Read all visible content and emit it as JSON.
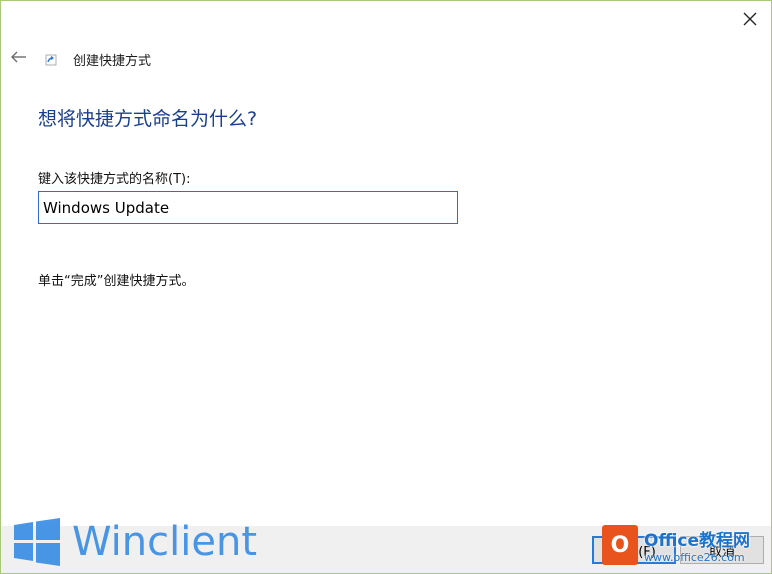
{
  "window": {
    "title": "创建快捷方式"
  },
  "icons": {
    "close": "close-icon",
    "back": "back-arrow-icon",
    "wizard": "shortcut-wizard-icon"
  },
  "main": {
    "heading": "想将快捷方式命名为什么?",
    "field_label": "键入该快捷方式的名称(T):",
    "name_value": "Windows Update",
    "hint": "单击“完成”创建快捷方式。"
  },
  "footer": {
    "finish_label": "完成(F)",
    "cancel_label": "取消"
  },
  "watermarks": {
    "winclient": "Winclient",
    "office_brand": "Office教程网",
    "office_url": "www.office26.com"
  },
  "colors": {
    "heading": "#1b3f8f",
    "input_border": "#2e6fc9",
    "footer_bg": "#f0f0f0",
    "accent": "#2b78d4"
  }
}
